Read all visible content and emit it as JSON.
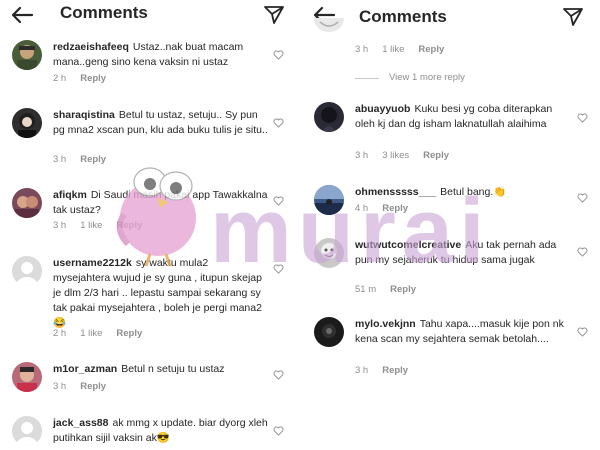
{
  "left_panel": {
    "title": "Comments",
    "comments": [
      {
        "user": "redzaeishafeeq",
        "text": "Ustaz..nak buat macam mana..geng sino kena vaksin ni ustaz",
        "time": "2 h",
        "likes": "",
        "reply": "Reply"
      },
      {
        "user": "sharaqistina",
        "text": "Betul tu ustaz, setuju.. Sy pun pg mna2 xscan pun, klu ada buku tulis je situ..",
        "time": "3 h",
        "likes": "",
        "reply": "Reply"
      },
      {
        "user": "afiqkm",
        "text": "Di Saudi masih pakai app Tawakkalna tak ustaz?",
        "time": "3 h",
        "likes": "1 like",
        "reply": "Reply"
      },
      {
        "user": "username2212k",
        "text": "sy waktu mula2 mysejahtera wujud je sy guna , itupun skejap je dlm 2/3 hari .. lepastu sampai sekarang sy tak pakai mysejahtera , boleh je pergi mana2 😂",
        "time": "2 h",
        "likes": "1 like",
        "reply": "Reply"
      },
      {
        "user": "m1or_azman",
        "text": "Betul n setuju tu ustaz",
        "time": "3 h",
        "likes": "",
        "reply": "Reply"
      },
      {
        "user": "jack_ass88",
        "text": "ak mmg x update. biar dyorg xleh putihkan sijil vaksin ak😎",
        "time": "",
        "likes": "",
        "reply": ""
      }
    ]
  },
  "right_panel": {
    "title": "Comments",
    "top_meta": {
      "time": "3 h",
      "likes": "1 like",
      "reply": "Reply"
    },
    "view_more": "View 1 more reply",
    "comments": [
      {
        "user": "abuayyuob",
        "text": "Kuku besi yg coba diterapkan oleh kj dan dg isham laknatullah alaihima",
        "time": "3 h",
        "likes": "3 likes",
        "reply": "Reply"
      },
      {
        "user": "ohmensssss___",
        "text": "Betul bang.👏",
        "time": "4 h",
        "likes": "",
        "reply": "Reply"
      },
      {
        "user": "wutwutcomelcreative",
        "text": "Aku tak pernah ada pun my sejaheruk tu hidup sama jugak",
        "time": "51 m",
        "likes": "",
        "reply": "Reply"
      },
      {
        "user": "mylo.vekjnn",
        "text": "Tahu xapa....masuk kije pon nk kena scan my sejahtera semak betolah....",
        "time": "3 h",
        "likes": "",
        "reply": "Reply"
      }
    ]
  },
  "watermark": {
    "text": "murai"
  },
  "icons": {
    "back": "back-arrow-icon",
    "send": "send-paper-plane-icon",
    "heart": "heart-outline-icon"
  },
  "colors": {
    "text": "#262626",
    "secondary": "#8e8e8e",
    "watermark": "#c9a3d6"
  }
}
